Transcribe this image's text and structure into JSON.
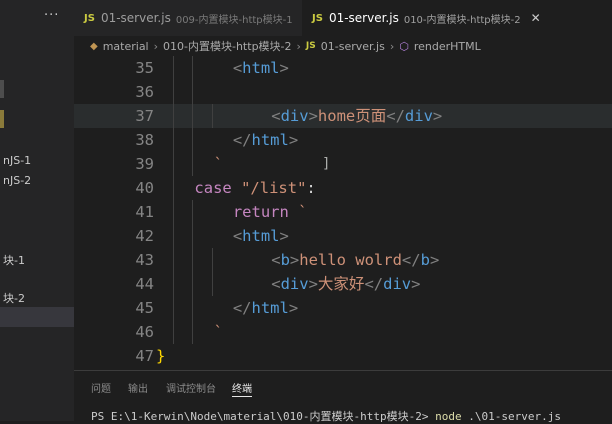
{
  "sidebar": {
    "more_label": "···",
    "items": [
      {
        "label": "nJS-1"
      },
      {
        "label": "nJS-2"
      },
      {
        "label": "块-1"
      },
      {
        "label": "块-2"
      },
      {
        "label": ""
      }
    ]
  },
  "tabs": [
    {
      "icon": "JS",
      "name": "01-server.js",
      "dir": "009-内置模块-http模块-1",
      "active": false
    },
    {
      "icon": "JS",
      "name": "01-server.js",
      "dir": "010-内置模块-http模块-2",
      "active": true,
      "close": "✕"
    }
  ],
  "breadcrumb": {
    "items": [
      "material",
      "010-内置模块-http模块-2",
      "01-server.js",
      "renderHTML"
    ],
    "separator": "›",
    "file_icon": "JS"
  },
  "editor": {
    "lines": [
      {
        "n": "35",
        "tokens": [
          {
            "t": "<",
            "c": "k-bracket"
          },
          {
            "t": "html",
            "c": "k-tag"
          },
          {
            "t": ">",
            "c": "k-bracket"
          }
        ],
        "indent": 5
      },
      {
        "n": "36",
        "tokens": [],
        "indent": 5
      },
      {
        "n": "37",
        "tokens": [
          {
            "t": "<",
            "c": "k-bracket"
          },
          {
            "t": "div",
            "c": "k-tag"
          },
          {
            "t": ">",
            "c": "k-bracket"
          },
          {
            "t": "home页面",
            "c": "k-str"
          },
          {
            "t": "</",
            "c": "k-bracket"
          },
          {
            "t": "div",
            "c": "k-tag"
          },
          {
            "t": ">",
            "c": "k-bracket"
          }
        ],
        "indent": 7,
        "hl": true
      },
      {
        "n": "38",
        "tokens": [
          {
            "t": "</",
            "c": "k-bracket"
          },
          {
            "t": "html",
            "c": "k-tag"
          },
          {
            "t": ">",
            "c": "k-bracket"
          }
        ],
        "indent": 5
      },
      {
        "n": "39",
        "tokens": [
          {
            "t": "`",
            "c": "k-str"
          }
        ],
        "indent": 4
      },
      {
        "n": "40",
        "tokens": [
          {
            "t": "case ",
            "c": "k-case"
          },
          {
            "t": "\"/list\"",
            "c": "k-str"
          },
          {
            "t": ":",
            "c": "k-plain"
          }
        ],
        "indent": 3
      },
      {
        "n": "41",
        "tokens": [
          {
            "t": "return ",
            "c": "k-kw"
          },
          {
            "t": "`",
            "c": "k-str"
          }
        ],
        "indent": 5
      },
      {
        "n": "42",
        "tokens": [
          {
            "t": "<",
            "c": "k-bracket"
          },
          {
            "t": "html",
            "c": "k-tag"
          },
          {
            "t": ">",
            "c": "k-bracket"
          }
        ],
        "indent": 5
      },
      {
        "n": "43",
        "tokens": [
          {
            "t": "<",
            "c": "k-bracket"
          },
          {
            "t": "b",
            "c": "k-tag"
          },
          {
            "t": ">",
            "c": "k-bracket"
          },
          {
            "t": "hello wolrd",
            "c": "k-str"
          },
          {
            "t": "</",
            "c": "k-bracket"
          },
          {
            "t": "b",
            "c": "k-tag"
          },
          {
            "t": ">",
            "c": "k-bracket"
          }
        ],
        "indent": 7
      },
      {
        "n": "44",
        "tokens": [
          {
            "t": "<",
            "c": "k-bracket"
          },
          {
            "t": "div",
            "c": "k-tag"
          },
          {
            "t": ">",
            "c": "k-bracket"
          },
          {
            "t": "大家好",
            "c": "k-str"
          },
          {
            "t": "</",
            "c": "k-bracket"
          },
          {
            "t": "div",
            "c": "k-tag"
          },
          {
            "t": ">",
            "c": "k-bracket"
          }
        ],
        "indent": 7
      },
      {
        "n": "45",
        "tokens": [
          {
            "t": "</",
            "c": "k-bracket"
          },
          {
            "t": "html",
            "c": "k-tag"
          },
          {
            "t": ">",
            "c": "k-bracket"
          }
        ],
        "indent": 5
      },
      {
        "n": "46",
        "tokens": [
          {
            "t": "`",
            "c": "k-str"
          }
        ],
        "indent": 4
      },
      {
        "n": "47",
        "tokens": [
          {
            "t": "}",
            "c": "k-brace"
          }
        ],
        "indent": 1
      }
    ]
  },
  "panel": {
    "tabs": [
      "问题",
      "输出",
      "调试控制台",
      "终端"
    ],
    "active_tab": "终端",
    "terminal_prompt": "PS E:\\1-Kerwin\\Node\\material\\010-内置模块-http模块-2> ",
    "terminal_cmd": "node",
    "terminal_arg": " .\\01-server.js"
  },
  "colors": {
    "background": "#1e1e1e",
    "sidebar": "#252526",
    "tag": "#569cd6",
    "string": "#ce9178",
    "keyword": "#c586c0",
    "js_icon": "#cbcb41"
  }
}
